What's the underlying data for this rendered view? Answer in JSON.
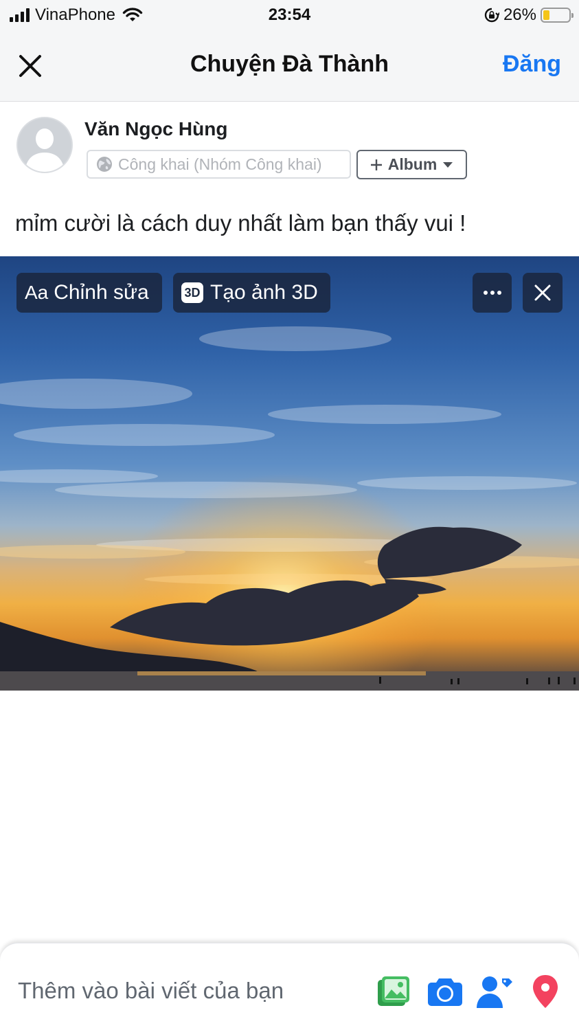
{
  "status_bar": {
    "carrier": "VinaPhone",
    "time": "23:54",
    "battery": "26%",
    "battery_level": 0.26,
    "icons": [
      "signal-icon",
      "wifi-icon",
      "rotation-lock-icon",
      "battery-icon"
    ]
  },
  "header": {
    "close_icon": "close-icon",
    "title": "Chuyện Đà Thành",
    "post_label": "Đăng"
  },
  "author": {
    "name": "Văn Ngọc Hùng",
    "privacy_label": "Công khai (Nhóm Công khai)",
    "privacy_icon": "globe-icon",
    "album_label": "Album",
    "album_icons": [
      "plus-icon",
      "caret-down-icon"
    ]
  },
  "post": {
    "text": "mỉm cười là cách duy nhất làm bạn thấy vui !"
  },
  "photo": {
    "edit_prefix": "Aa",
    "edit_label": "Chỉnh sửa",
    "badge_3d": "3D",
    "create_3d_label": "Tạo ảnh 3D",
    "more_icon": "more-icon",
    "remove_icon": "close-icon"
  },
  "bottom_bar": {
    "add_label": "Thêm vào bài viết của bạn",
    "tools": [
      "photo-video-icon",
      "camera-icon",
      "tag-people-icon",
      "location-pin-icon"
    ]
  },
  "colors": {
    "accent": "#1877f2",
    "photo_icon": "#45bd62",
    "tag_icon": "#1877f2",
    "location_icon": "#f3425f",
    "battery": "#f5c518"
  }
}
